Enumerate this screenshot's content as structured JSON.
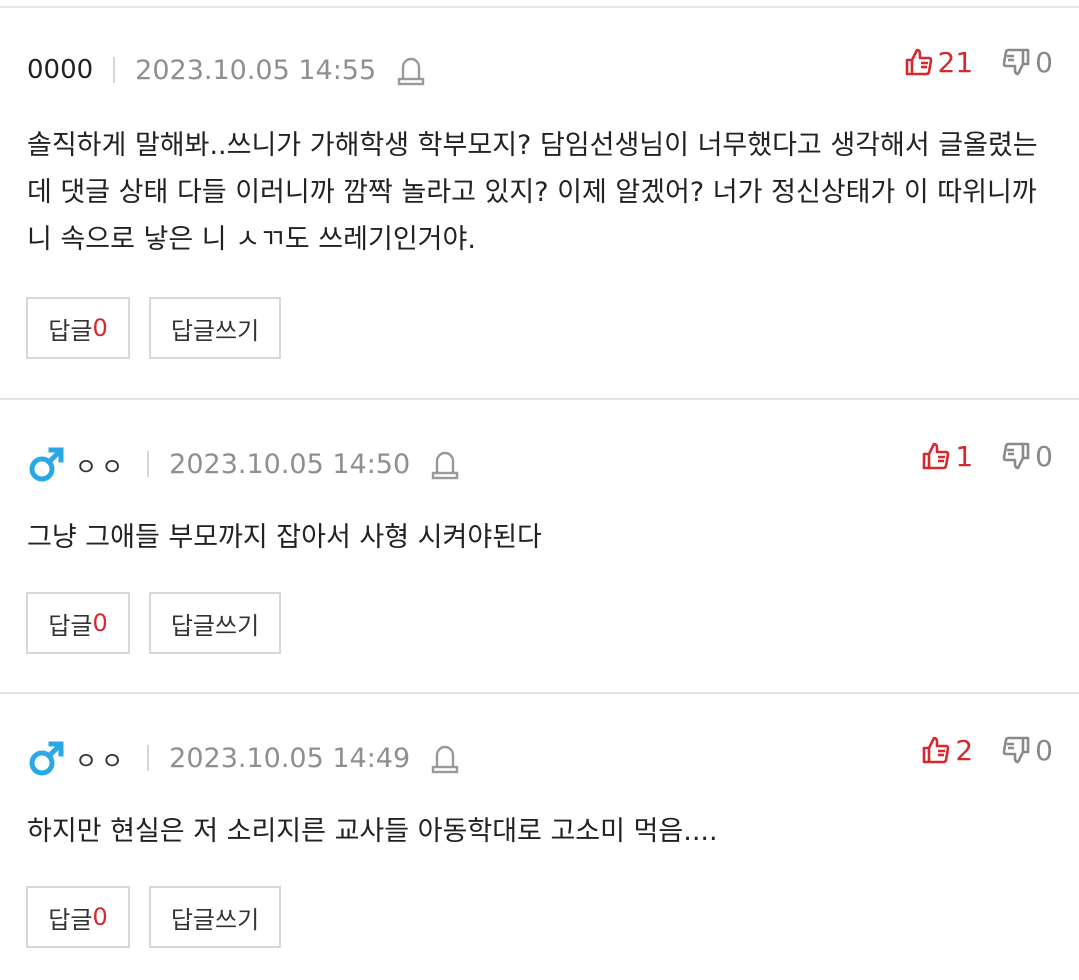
{
  "comments": [
    {
      "gender_icon": "",
      "author": "0000",
      "date": "2023.10.05 14:55",
      "upvotes": "21",
      "downvotes": "0",
      "body": "솔직하게 말해봐..쓰니가 가해학생 학부모지? 담임선생님이 너무했다고 생각해서 글올렸는데 댓글 상태 다들 이러니까 깜짝 놀라고 있지? 이제 알겠어? 너가 정신상태가 이 따위니까 니 속으로 낳은 니 ㅅㄲ도 쓰레기인거야.",
      "reply_label": "답글",
      "reply_count": "0",
      "write_reply_label": "답글쓰기"
    },
    {
      "gender_icon": "male-icon",
      "author": "ㅇㅇ",
      "date": "2023.10.05 14:50",
      "upvotes": "1",
      "downvotes": "0",
      "body": "그냥 그애들 부모까지 잡아서 사형 시켜야된다",
      "reply_label": "답글",
      "reply_count": "0",
      "write_reply_label": "답글쓰기"
    },
    {
      "gender_icon": "male-icon",
      "author": "ㅇㅇ",
      "date": "2023.10.05 14:49",
      "upvotes": "2",
      "downvotes": "0",
      "body": "하지만 현실은 저 소리지른 교사들 아동학대로 고소미 먹음....",
      "reply_label": "답글",
      "reply_count": "0",
      "write_reply_label": "답글쓰기"
    }
  ],
  "colors": {
    "upvote": "#d7282f",
    "male_icon": "#29a8e6",
    "date": "#8f8f8f"
  }
}
